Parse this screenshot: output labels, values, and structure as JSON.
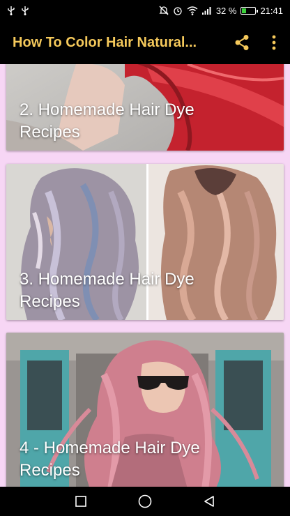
{
  "status_bar": {
    "battery_percent": "32 %",
    "battery_level": 0.32,
    "time": "21:41",
    "left_icons": [
      "usb-icon",
      "usb-icon"
    ],
    "right_icons": [
      "mute-icon",
      "alarm-icon",
      "wifi-icon",
      "signal-icon",
      "battery-icon"
    ]
  },
  "app_bar": {
    "title": "How To Color Hair Natural...",
    "title_color": "#f5c95b",
    "actions": [
      "share-icon",
      "more-vert-icon"
    ]
  },
  "background_color": "#f7d6f5",
  "cards": [
    {
      "title": "2. Homemade Hair Dye Recipes",
      "image": "woman-with-red-hair-photo"
    },
    {
      "title": "3. Homemade Hair Dye Recipes",
      "image": "pastel-wavy-hair-photos"
    },
    {
      "title": "4 - Homemade Hair Dye Recipes",
      "image": "woman-with-pink-hair-and-sunglasses-photo"
    }
  ],
  "nav_bar": {
    "buttons": [
      "recents-square-icon",
      "home-circle-icon",
      "back-triangle-icon"
    ]
  }
}
